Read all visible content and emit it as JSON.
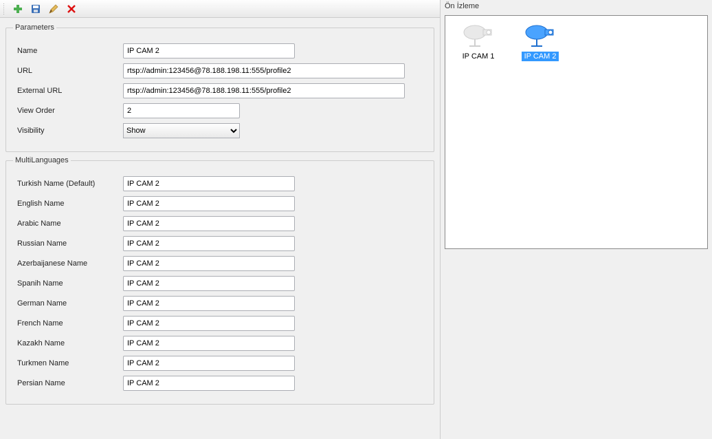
{
  "toolbar": {
    "add_icon": "add-icon",
    "save_icon": "save-icon",
    "edit_icon": "edit-icon",
    "delete_icon": "delete-icon"
  },
  "parameters": {
    "legend": "Parameters",
    "name_label": "Name",
    "name_value": "IP CAM 2",
    "url_label": "URL",
    "url_value": "rtsp://admin:123456@78.188.198.11:555/profile2",
    "external_url_label": "External URL",
    "external_url_value": "rtsp://admin:123456@78.188.198.11:555/profile2",
    "view_order_label": "View Order",
    "view_order_value": "2",
    "visibility_label": "Visibility",
    "visibility_value": "Show"
  },
  "multi_languages": {
    "legend": "MultiLanguages",
    "rows": [
      {
        "label": "Turkish Name (Default)",
        "value": "IP CAM 2"
      },
      {
        "label": "English Name",
        "value": "IP CAM 2"
      },
      {
        "label": "Arabic Name",
        "value": "IP CAM 2"
      },
      {
        "label": "Russian Name",
        "value": "IP CAM 2"
      },
      {
        "label": "Azerbaijanese Name",
        "value": "IP CAM 2"
      },
      {
        "label": "Spanih Name",
        "value": "IP CAM 2"
      },
      {
        "label": "German Name",
        "value": "IP CAM 2"
      },
      {
        "label": "French Name",
        "value": "IP CAM 2"
      },
      {
        "label": "Kazakh Name",
        "value": "IP CAM 2"
      },
      {
        "label": "Turkmen Name",
        "value": "IP CAM 2"
      },
      {
        "label": "Persian Name",
        "value": "IP CAM 2"
      }
    ]
  },
  "preview": {
    "title": "Ön İzleme",
    "items": [
      {
        "label": "IP CAM 1",
        "selected": false
      },
      {
        "label": "IP CAM 2",
        "selected": true
      }
    ]
  }
}
